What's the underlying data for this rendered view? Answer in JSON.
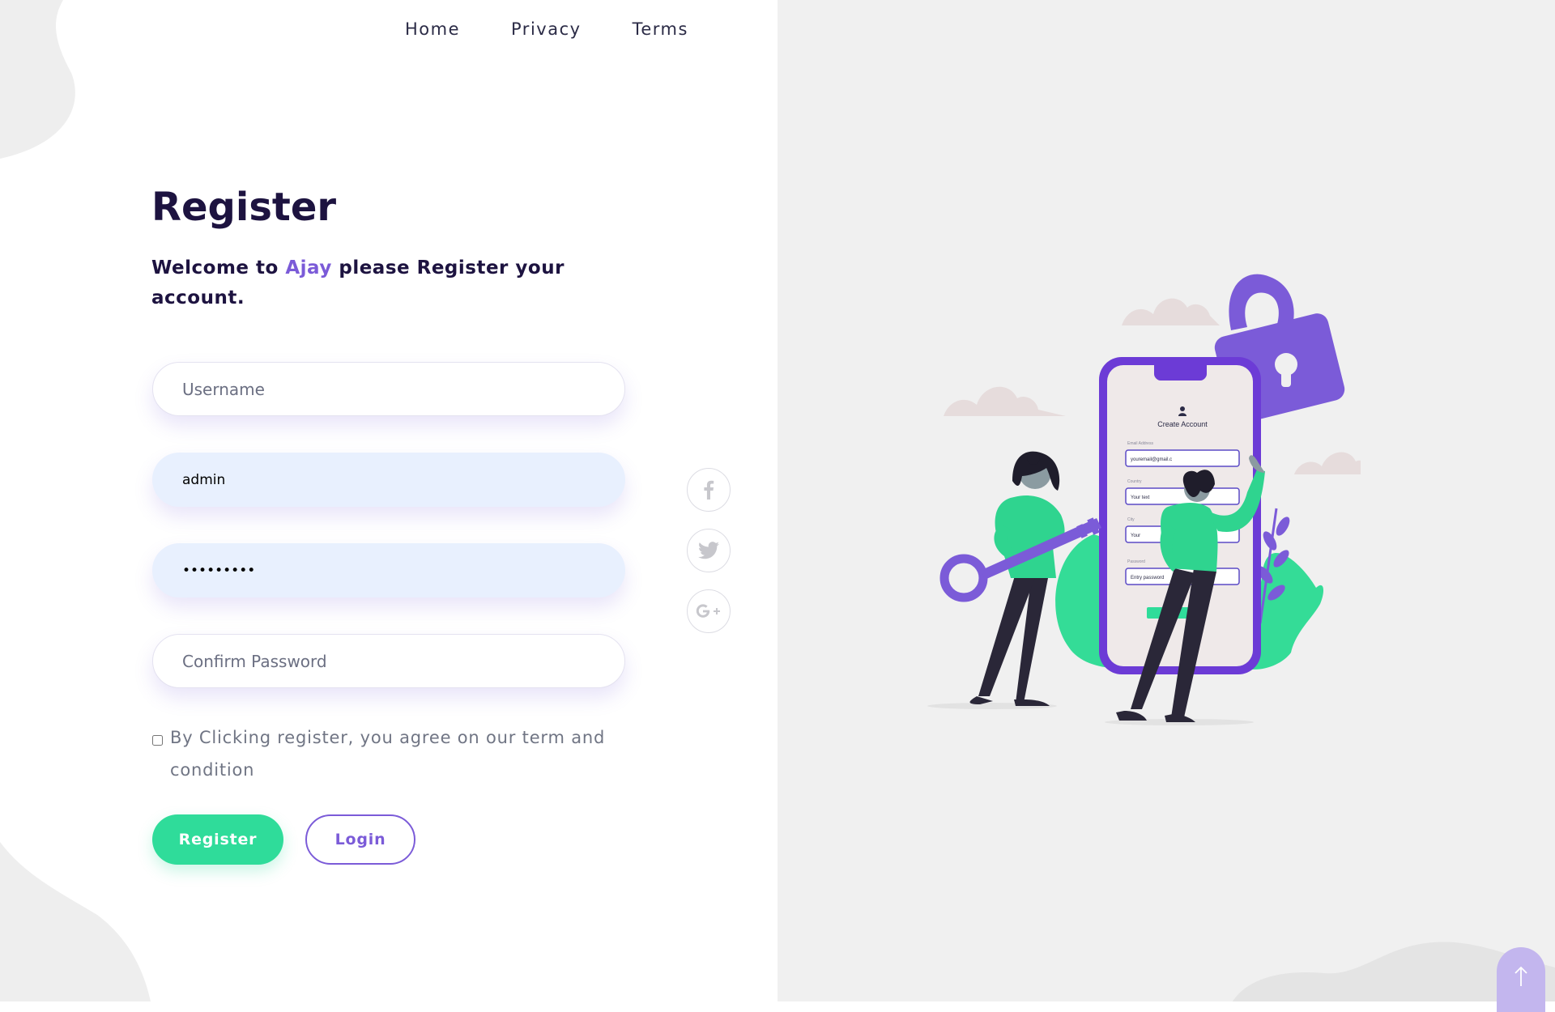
{
  "nav": {
    "items": [
      "Home",
      "Privacy",
      "Terms"
    ]
  },
  "form": {
    "title": "Register",
    "subtitle_prefix": "Welcome to ",
    "subtitle_brand": "Ajay",
    "subtitle_suffix": " please Register your account.",
    "username_placeholder": "Username",
    "email_value": "admin",
    "password_value": "•••••••••",
    "confirm_placeholder": "Confirm Password",
    "agree_text": "By Clicking register, you agree on our term and condition",
    "agree_checked": false,
    "register_label": "Register",
    "login_label": "Login"
  },
  "social": {
    "icons": [
      "facebook-icon",
      "twitter-icon",
      "google-plus-icon"
    ]
  },
  "illustration": {
    "heading": "Create Account",
    "field_labels": [
      "Email Address",
      "Country",
      "City",
      "Password"
    ],
    "field_values": [
      "youremail@gmail.c",
      "Your text",
      "Your",
      "Entry password"
    ]
  },
  "colors": {
    "accent": "#7b5bd8",
    "primary_green": "#2fdc9a",
    "dark_text": "#1d1340",
    "right_bg": "#f0f0f0"
  }
}
